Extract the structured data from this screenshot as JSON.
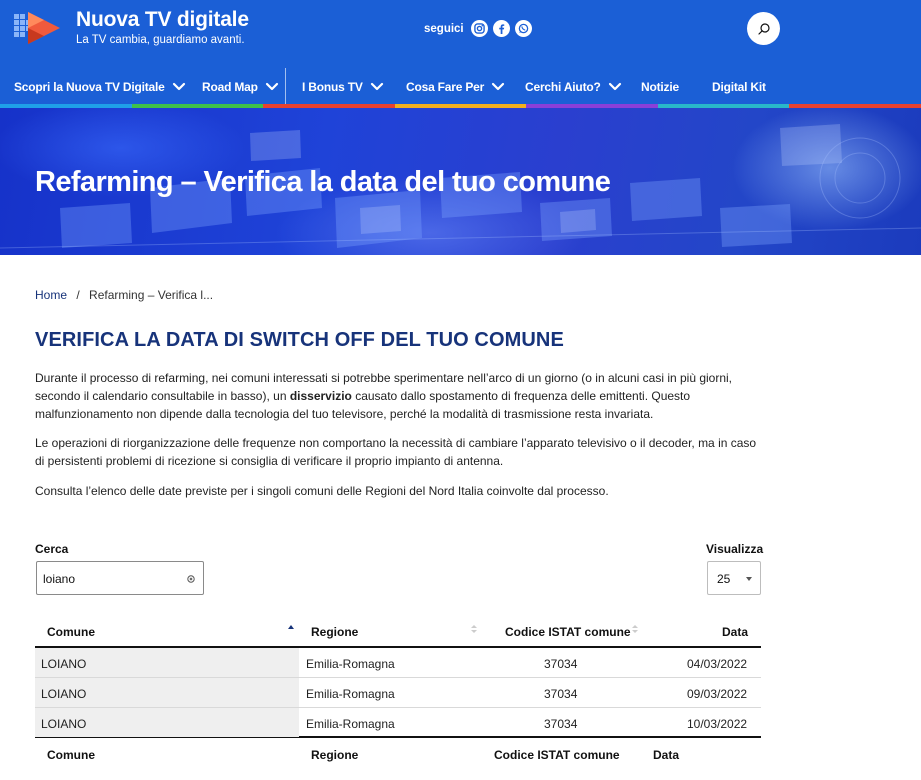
{
  "brand": {
    "title": "Nuova TV digitale",
    "subtitle": "La TV cambia, guardiamo avanti."
  },
  "social": {
    "label": "seguici",
    "icons": [
      "instagram-icon",
      "facebook-icon",
      "whatsapp-icon"
    ]
  },
  "nav": {
    "items": [
      {
        "label": "Scopri la Nuova TV Digitale",
        "dropdown": true
      },
      {
        "label": "Road Map",
        "dropdown": true
      },
      {
        "label": "I Bonus TV",
        "dropdown": true
      },
      {
        "label": "Cosa Fare Per",
        "dropdown": true
      },
      {
        "label": "Cerchi Aiuto?",
        "dropdown": true
      },
      {
        "label": "Notizie",
        "dropdown": false
      },
      {
        "label": "Digital Kit",
        "dropdown": false
      }
    ],
    "stripe_colors": [
      "#1fa0e8",
      "#3ec14a",
      "#e8412f",
      "#f2b01e",
      "#8a3fd8",
      "#29b8c9",
      "#e8412f"
    ]
  },
  "hero": {
    "title": "Refarming – Verifica la data del tuo comune"
  },
  "breadcrumb": {
    "home": "Home",
    "separator": "/",
    "current": "Refarming – Verifica l..."
  },
  "page": {
    "title": "VERIFICA LA DATA DI SWITCH OFF DEL TUO COMUNE",
    "p1_before": "Durante il processo di refarming, nei comuni interessati si potrebbe sperimentare nell’arco di un giorno (o in alcuni casi in più giorni, secondo il calendario consultabile in basso), un ",
    "p1_bold": "disservizio",
    "p1_after": " causato dallo spostamento di frequenza delle emittenti. Questo malfunzionamento non dipende dalla tecnologia del tuo televisore, perché la modalità di trasmissione resta invariata.",
    "p2": "Le operazioni di riorganizzazione delle frequenze non comportano la necessità di cambiare l’apparato televisivo o il decoder, ma in caso di persistenti problemi di ricezione si consiglia di verificare il proprio impianto di antenna.",
    "p3": "Consulta l’elenco delle date previste per i singoli comuni delle Regioni del Nord Italia coinvolte dal processo."
  },
  "search": {
    "label": "Cerca",
    "value": "loiano"
  },
  "length": {
    "label": "Visualizza",
    "value": "25"
  },
  "table": {
    "columns": [
      "Comune",
      "Regione",
      "Codice ISTAT comune",
      "Data"
    ],
    "rows": [
      [
        "LOIANO",
        "Emilia-Romagna",
        "37034",
        "04/03/2022"
      ],
      [
        "LOIANO",
        "Emilia-Romagna",
        "37034",
        "09/03/2022"
      ],
      [
        "LOIANO",
        "Emilia-Romagna",
        "37034",
        "10/03/2022"
      ]
    ]
  }
}
